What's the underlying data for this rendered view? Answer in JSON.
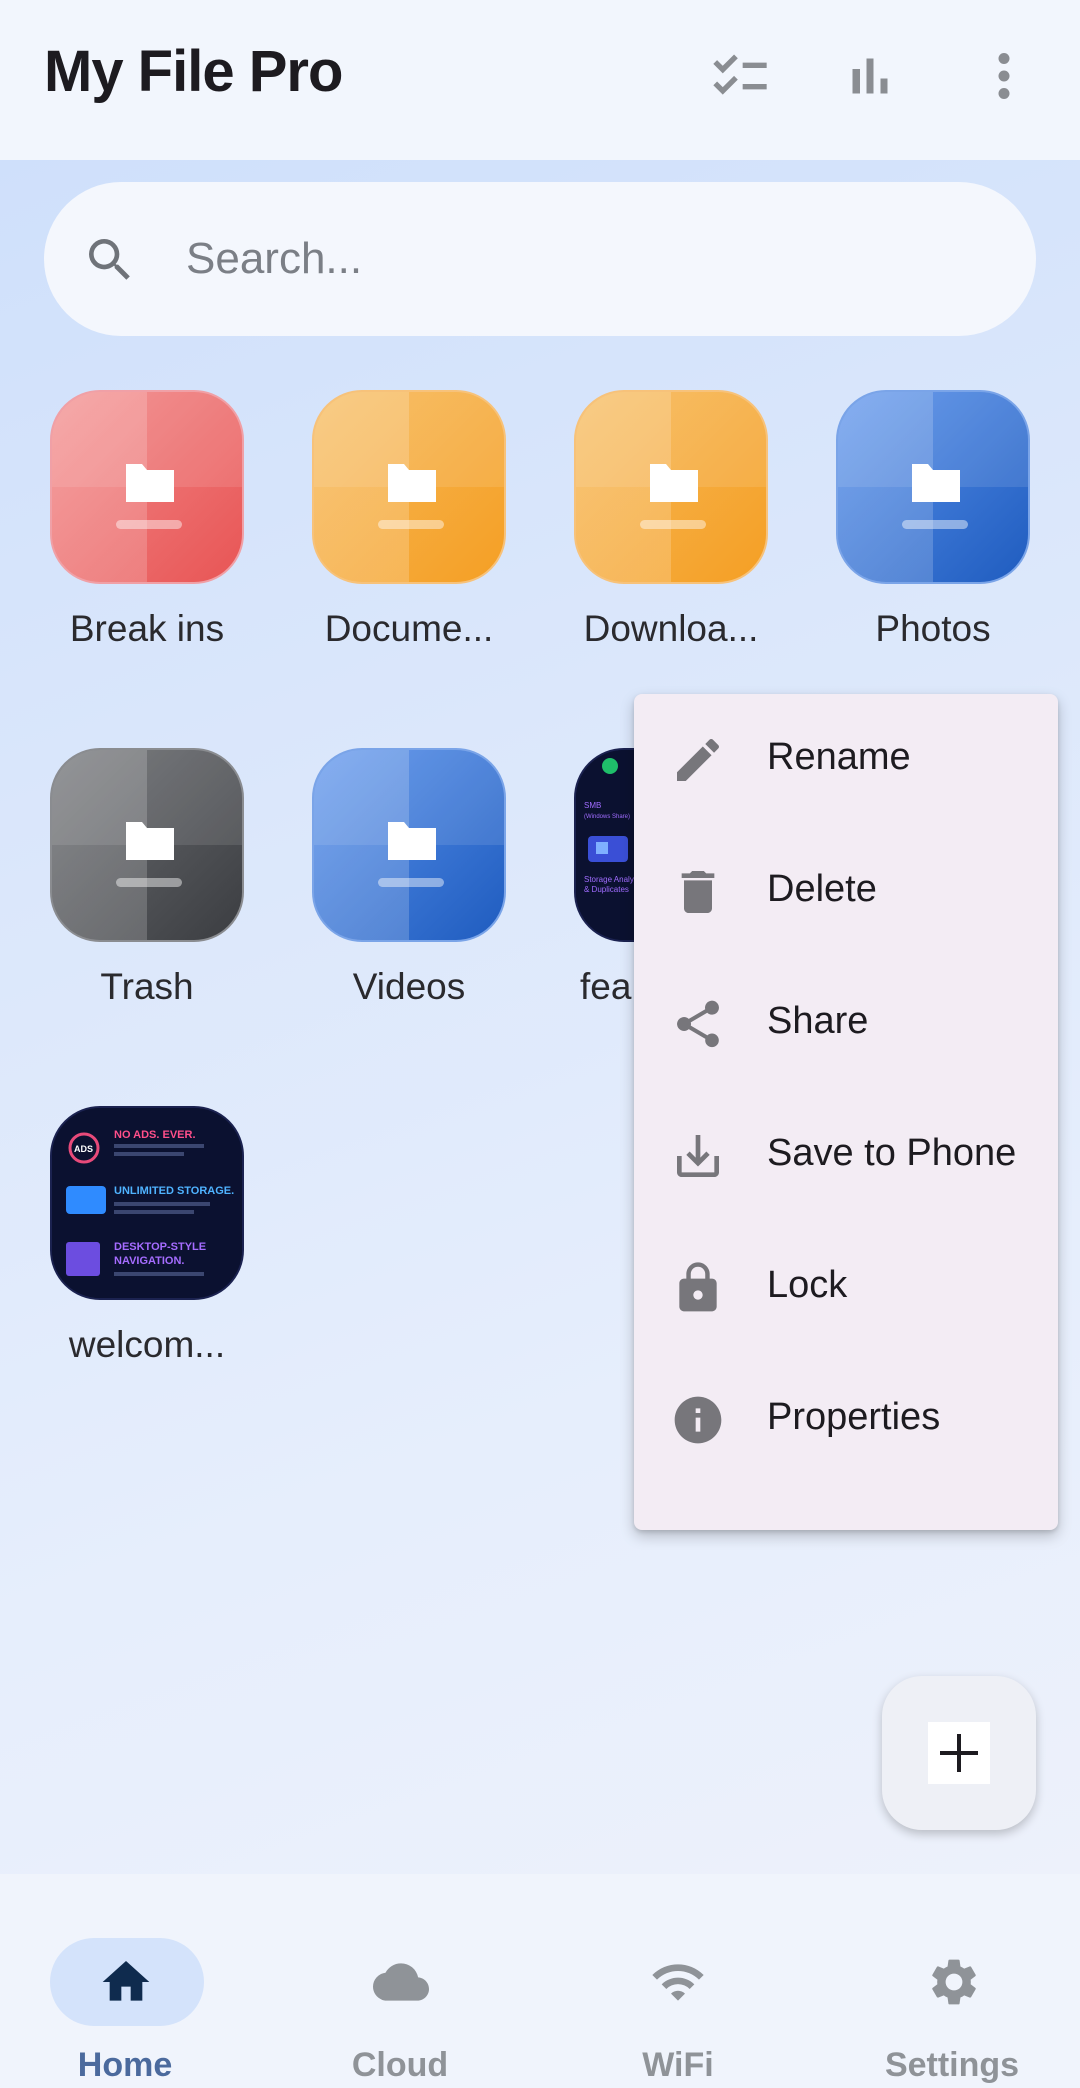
{
  "header": {
    "title": "My File Pro",
    "icons": [
      "checklist-icon",
      "bar-chart-icon",
      "more-vert-icon"
    ]
  },
  "search": {
    "placeholder": "Search..."
  },
  "files": [
    {
      "label": "Break ins",
      "color": "#e85555",
      "kind": "folder"
    },
    {
      "label": "Docume...",
      "color": "#f59f24",
      "kind": "folder"
    },
    {
      "label": "Downloa...",
      "color": "#f59f24",
      "kind": "folder"
    },
    {
      "label": "Photos",
      "color": "#1f5cbf",
      "kind": "folder"
    },
    {
      "label": "Trash",
      "color": "#3b3d41",
      "kind": "folder"
    },
    {
      "label": "Videos",
      "color": "#1f5cbf",
      "kind": "folder"
    },
    {
      "label": "fea",
      "kind": "image-thumbnail",
      "thumb_text": [
        "SMB",
        "(Windows Share)",
        "Storage Analy",
        "& Duplicates"
      ]
    },
    {
      "label": "welcom...",
      "kind": "image-thumbnail",
      "thumb_text": [
        "NO ADS. EVER.",
        "UNLIMITED STORAGE.",
        "DESKTOP-STYLE",
        "NAVIGATION.",
        "ADS"
      ]
    }
  ],
  "context_menu": {
    "items": [
      {
        "label": "Rename",
        "icon": "pencil-icon"
      },
      {
        "label": "Delete",
        "icon": "trash-icon"
      },
      {
        "label": "Share",
        "icon": "share-icon"
      },
      {
        "label": "Save to Phone",
        "icon": "download-icon"
      },
      {
        "label": "Lock",
        "icon": "lock-icon"
      },
      {
        "label": "Properties",
        "icon": "info-icon"
      }
    ]
  },
  "fab": {
    "icon": "plus-icon"
  },
  "bottom_nav": {
    "active": "Home",
    "items": [
      {
        "label": "Home",
        "icon": "home-icon"
      },
      {
        "label": "Cloud",
        "icon": "cloud-icon"
      },
      {
        "label": "WiFi",
        "icon": "wifi-icon"
      },
      {
        "label": "Settings",
        "icon": "gear-icon"
      }
    ]
  },
  "colors": {
    "accent": "#4b6a9d",
    "nav_active_pill": "#d4e3fb",
    "menu_background": "#f3ecf4"
  }
}
